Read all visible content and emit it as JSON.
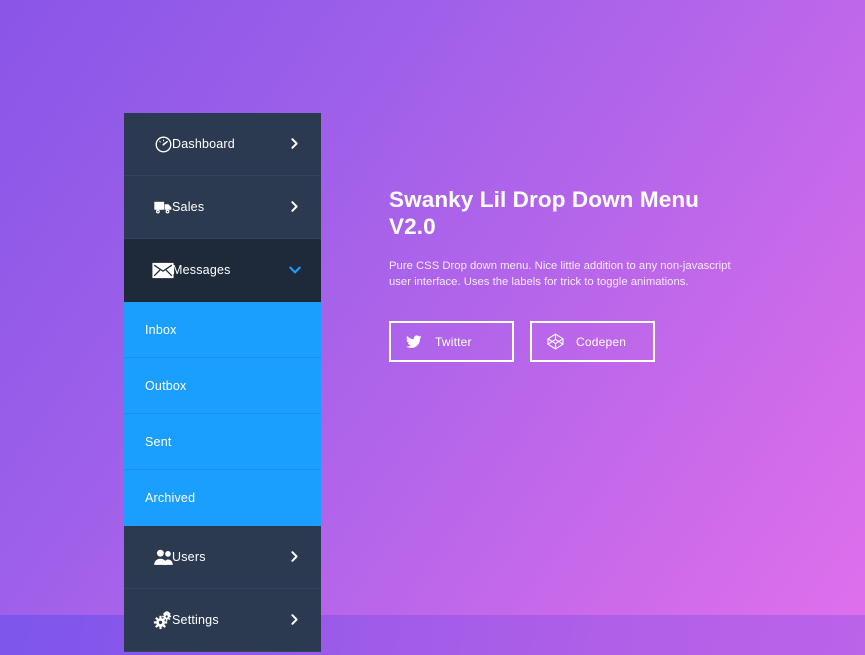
{
  "theme": {
    "bg_start": "#8a55e8",
    "bg_end": "#e070ec",
    "menu_bg": "#2b3a50",
    "menu_open_bg": "#1e2a3a",
    "submenu_bg": "#1a9fff",
    "accent_blue": "#1a9fff",
    "text_white": "#ffffff"
  },
  "menu": {
    "items": [
      {
        "label": "Dashboard",
        "icon": "dashboard-gauge-icon",
        "chevron": "chevron-right-icon",
        "expanded": false
      },
      {
        "label": "Sales",
        "icon": "truck-icon",
        "chevron": "chevron-right-icon",
        "expanded": false
      },
      {
        "label": "Messages",
        "icon": "envelope-icon",
        "chevron": "chevron-down-icon",
        "expanded": true
      },
      {
        "label": "Users",
        "icon": "users-icon",
        "chevron": "chevron-right-icon",
        "expanded": false
      },
      {
        "label": "Settings",
        "icon": "gears-icon",
        "chevron": "chevron-right-icon",
        "expanded": false
      }
    ],
    "submenu": {
      "parent": "Messages",
      "items": [
        {
          "label": "Inbox"
        },
        {
          "label": "Outbox"
        },
        {
          "label": "Sent"
        },
        {
          "label": "Archived"
        }
      ]
    }
  },
  "content": {
    "title": "Swanky Lil Drop Down Menu V2.0",
    "description": "Pure CSS Drop down menu. Nice little addition to any non-javascript user interface. Uses the labels for trick to toggle animations.",
    "buttons": [
      {
        "label": "Twitter",
        "icon": "twitter-bird-icon"
      },
      {
        "label": "Codepen",
        "icon": "codepen-icon"
      }
    ]
  }
}
